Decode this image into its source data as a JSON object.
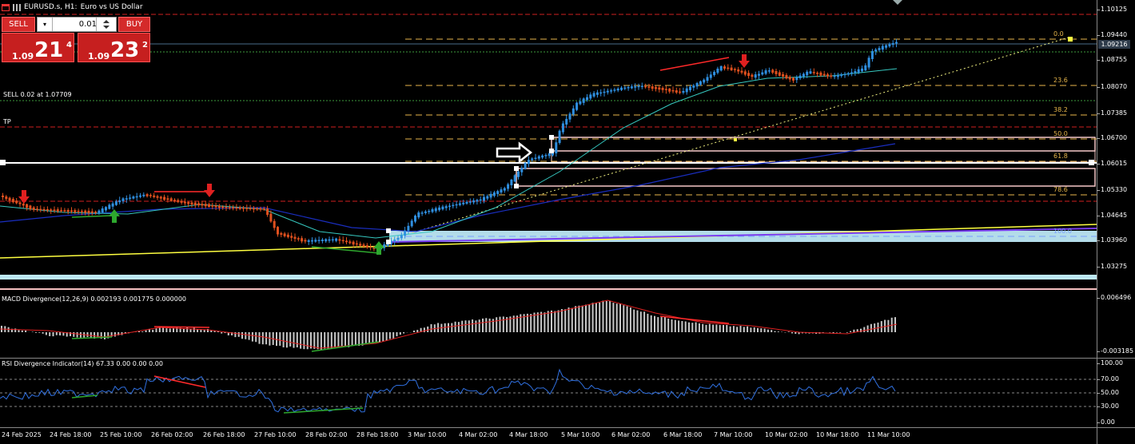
{
  "chart_header": {
    "symbol": "EURUSD.s, H1:",
    "description": "Euro vs US Dollar"
  },
  "trade_panel": {
    "sell_label": "SELL",
    "buy_label": "BUY",
    "lot_value": "0.01",
    "sell_prefix": "1.09",
    "sell_big": "21",
    "sell_sup": "4",
    "buy_prefix": "1.09",
    "buy_big": "23",
    "buy_sup": "2"
  },
  "price_axis": {
    "ticks": [
      "1.10125",
      "1.09440",
      "1.08755",
      "1.08070",
      "1.07385",
      "1.06700",
      "1.06015",
      "1.05330",
      "1.04645",
      "1.03960",
      "1.03275"
    ],
    "current_price": "1.09216"
  },
  "order_labels": {
    "sell_order": "SELL 0.02 at 1.07709",
    "tp": "TP"
  },
  "fibonacci_levels": [
    "0.0",
    "23.6",
    "38.2",
    "50.0",
    "61.8",
    "78.6",
    "100.0"
  ],
  "macd": {
    "title": "MACD Divergence(12,26,9) 0.002193 0.001775 0.000000",
    "axis_ticks": [
      "0.006496",
      "-0.003185"
    ]
  },
  "rsi": {
    "title": "RSI Divergence Indicator(14) 67.33 0.00 0.00 0.00",
    "axis_ticks": [
      "100.00",
      "70.00",
      "50.00",
      "30.00",
      "0.00"
    ]
  },
  "time_axis": {
    "ticks": [
      "24 Feb 2025",
      "24 Feb 18:00",
      "25 Feb 10:00",
      "26 Feb 02:00",
      "26 Feb 18:00",
      "27 Feb 10:00",
      "28 Feb 02:00",
      "28 Feb 18:00",
      "3 Mar 10:00",
      "4 Mar 02:00",
      "4 Mar 18:00",
      "5 Mar 10:00",
      "6 Mar 02:00",
      "6 Mar 18:00",
      "7 Mar 10:00",
      "10 Mar 02:00",
      "10 Mar 18:00",
      "11 Mar 10:00"
    ]
  },
  "colors": {
    "bull": "#2f8fe0",
    "bear": "#e0501e",
    "fib": "#e7b64b",
    "trend": "#ffff40",
    "support_zone": "#bde8f5",
    "red_line": "#ff2a2a"
  }
}
